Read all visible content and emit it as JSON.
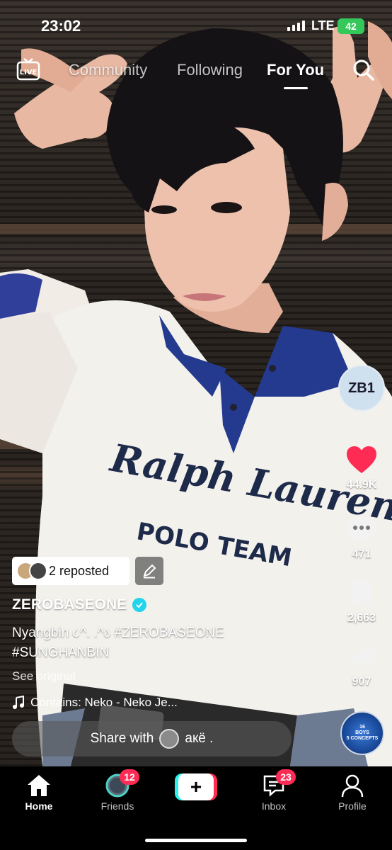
{
  "status_bar": {
    "time": "23:02",
    "network": "LTE",
    "battery": "42"
  },
  "top_nav": {
    "live_label": "LIVE",
    "tabs": [
      {
        "label": "Community"
      },
      {
        "label": "Following"
      },
      {
        "label": "For You",
        "active": true
      }
    ]
  },
  "video": {
    "shirt_text_1": "Ralph Lauren",
    "shirt_text_2": "POLO TEAM"
  },
  "side_actions": {
    "profile_label": "ZB1",
    "likes": "44.9K",
    "comments": "471",
    "saves": "2,663",
    "shares": "907",
    "music_disc_text_1": "16",
    "music_disc_text_2": "BOYS",
    "music_disc_text_3": "5 CONCEPTS"
  },
  "caption": {
    "repost_text": "2 reposted",
    "username": "ZEROBASEONE",
    "text_line1_prefix": "Nyangbin ૮^. .^ა ",
    "text_line1_tag": "#ZEROBASEONE",
    "text_line2_tag": "#SUNGHANBIN",
    "see_original": "See original",
    "music": "Contains: Neko - Neko Je..."
  },
  "share_bar": {
    "prefix": "Share with",
    "name": "aкë ."
  },
  "bottom_nav": {
    "home": "Home",
    "friends": "Friends",
    "friends_badge": "12",
    "inbox": "Inbox",
    "inbox_badge": "23",
    "profile": "Profile"
  },
  "colors": {
    "like_red": "#fe2c55",
    "verified": "#20d5ec",
    "battery": "#34c759"
  }
}
